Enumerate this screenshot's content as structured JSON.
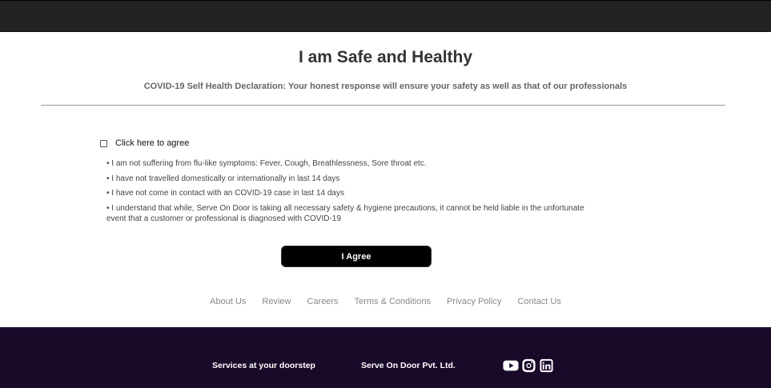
{
  "header": {
    "title": "I am Safe and Healthy",
    "subtitle": "COVID-19 Self Health Declaration: Your honest response will ensure your safety as well as that of our professionals"
  },
  "form": {
    "checkbox_label": "Click here to agree",
    "checkbox_checked": false,
    "points": [
      "• I am not suffering from flu-like symptoms: Fever, Cough, Breathlessness, Sore throat etc.",
      "• I have not travelled domestically or internationally in last 14 days",
      "• I have not come in contact with an COVID-19 case in last 14 days",
      "• I understand that while, Serve On Door is taking all necessary safety & hygiene precautions, it cannot be held liable in the unfortunate event that a customer or professional is diagnosed with COVID-19"
    ],
    "button_label": "I Agree"
  },
  "footer": {
    "links": [
      "About Us",
      "Review",
      "Careers",
      "Terms & Conditions",
      "Privacy Policy",
      "Contact Us"
    ],
    "tagline": "Services at your doorstep",
    "company": "Serve On Door Pvt. Ltd.",
    "social_icons": [
      "youtube-icon",
      "instagram-icon",
      "linkedin-icon"
    ]
  },
  "colors": {
    "topbar": "#222222",
    "bottombar": "#1a0a2a",
    "button_bg": "#000000",
    "link": "#888888"
  }
}
